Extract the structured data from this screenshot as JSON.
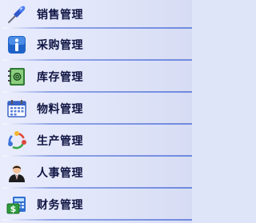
{
  "menu": {
    "items": [
      {
        "label": "销售管理",
        "icon": "pushpin-icon"
      },
      {
        "label": "采购管理",
        "icon": "info-icon"
      },
      {
        "label": "库存管理",
        "icon": "address-book-icon"
      },
      {
        "label": "物料管理",
        "icon": "calendar-icon"
      },
      {
        "label": "生产管理",
        "icon": "cycle-icon"
      },
      {
        "label": "人事管理",
        "icon": "person-icon"
      },
      {
        "label": "财务管理",
        "icon": "money-icon"
      }
    ]
  }
}
